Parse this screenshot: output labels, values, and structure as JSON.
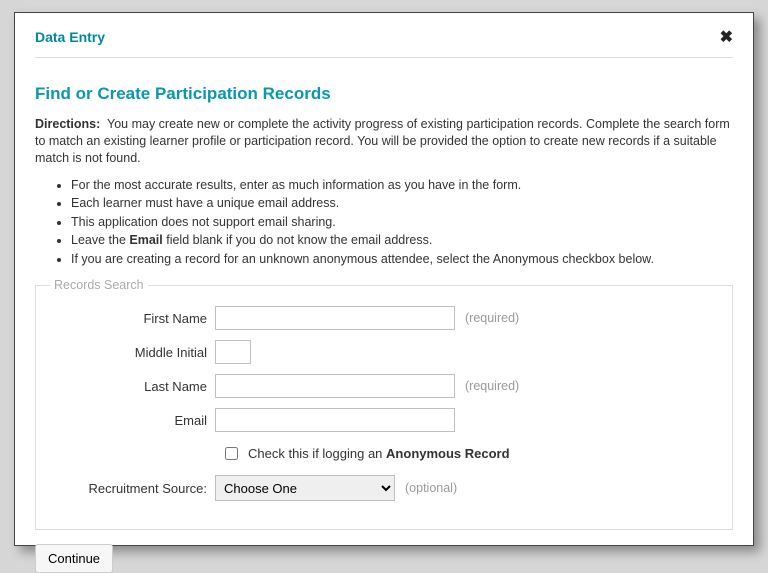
{
  "modal": {
    "title": "Data Entry"
  },
  "heading": "Find or Create Participation Records",
  "directions_label": "Directions:",
  "directions_text": "You may create new or complete the activity progress of existing participation records. Complete the search form to match an existing learner profile or participation record. You will be provided the option to create new records if a suitable match is not found.",
  "bullets": [
    {
      "text": "For the most accurate results, enter as much information as you have in the form."
    },
    {
      "text": "Each learner must have a unique email address."
    },
    {
      "text": "This application does not support email sharing."
    },
    {
      "prefix": "Leave the ",
      "bold": "Email",
      "suffix": " field blank if you do not know the email address."
    },
    {
      "text": "If you are creating a record for an unknown anonymous attendee, select the Anonymous checkbox below."
    }
  ],
  "fieldset_legend": "Records Search",
  "form": {
    "first_name": {
      "label": "First Name",
      "value": "",
      "hint": "(required)"
    },
    "middle_initial": {
      "label": "Middle Initial",
      "value": ""
    },
    "last_name": {
      "label": "Last Name",
      "value": "",
      "hint": "(required)"
    },
    "email": {
      "label": "Email",
      "value": ""
    },
    "anonymous": {
      "prefix": "Check this if logging an ",
      "bold": "Anonymous Record"
    },
    "recruitment": {
      "label": "Recruitment Source:",
      "selected": "Choose One",
      "hint": "(optional)"
    }
  },
  "continue_label": "Continue"
}
